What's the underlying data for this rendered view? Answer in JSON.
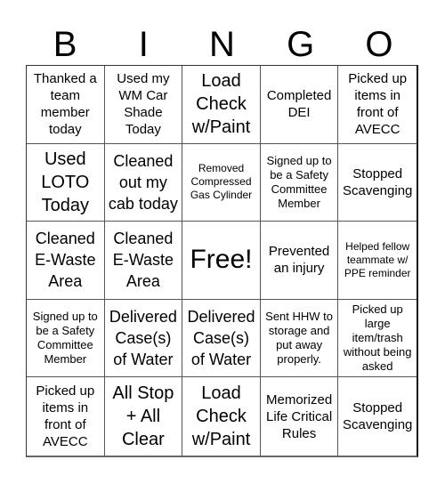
{
  "header": {
    "letters": [
      "B",
      "I",
      "N",
      "G",
      "O"
    ]
  },
  "board": {
    "rows": [
      [
        {
          "text": "Thanked a team member today",
          "size": "m"
        },
        {
          "text": "Used my WM Car Shade Today",
          "size": "m"
        },
        {
          "text": "Load Check w/Paint",
          "size": "xl"
        },
        {
          "text": "Completed DEI",
          "size": "m"
        },
        {
          "text": "Picked up items in front of AVECC",
          "size": "m"
        }
      ],
      [
        {
          "text": "Used LOTO Today",
          "size": "xl"
        },
        {
          "text": "Cleaned out my cab today",
          "size": "l"
        },
        {
          "text": "Removed Compressed Gas Cylinder",
          "size": "xs"
        },
        {
          "text": "Signed up to be a Safety Committee Member",
          "size": "s"
        },
        {
          "text": "Stopped Scavenging",
          "size": "m"
        }
      ],
      [
        {
          "text": "Cleaned E-Waste Area",
          "size": "l"
        },
        {
          "text": "Cleaned E-Waste Area",
          "size": "l"
        },
        {
          "text": "Free!",
          "size": "free"
        },
        {
          "text": "Prevented an injury",
          "size": "m"
        },
        {
          "text": "Helped fellow teammate w/ PPE reminder",
          "size": "xs"
        }
      ],
      [
        {
          "text": "Signed up to be a Safety Committee Member",
          "size": "s"
        },
        {
          "text": "Delivered Case(s) of Water",
          "size": "l"
        },
        {
          "text": "Delivered Case(s) of Water",
          "size": "l"
        },
        {
          "text": "Sent HHW to storage and put away properly.",
          "size": "s"
        },
        {
          "text": "Picked up large item/trash without being asked",
          "size": "s"
        }
      ],
      [
        {
          "text": "Picked up items in front of AVECC",
          "size": "m"
        },
        {
          "text": "All Stop + All Clear",
          "size": "xl"
        },
        {
          "text": "Load Check w/Paint",
          "size": "xl"
        },
        {
          "text": "Memorized Life Critical Rules",
          "size": "m"
        },
        {
          "text": "Stopped Scavenging",
          "size": "m"
        }
      ]
    ]
  }
}
